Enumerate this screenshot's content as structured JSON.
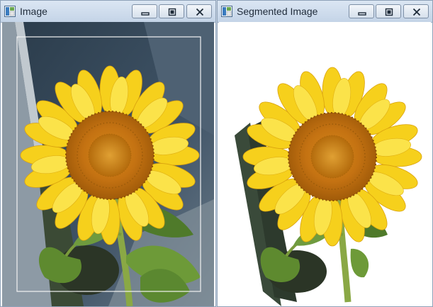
{
  "windows": [
    {
      "title": "Image",
      "icon": "image-window-icon",
      "buttons": [
        "minimize-icon",
        "maximize-icon",
        "close-icon"
      ]
    },
    {
      "title": "Segmented Image",
      "icon": "image-window-icon",
      "buttons": [
        "minimize-icon",
        "maximize-icon",
        "close-icon"
      ]
    }
  ],
  "colors": {
    "petal": "#f7d21a",
    "petal_dark": "#e4a90e",
    "disc_outer": "#c8780e",
    "disc_inner": "#a85c08",
    "leaf": "#5e8a2f",
    "stem": "#8aa845",
    "background_scene": "#2f4050",
    "segmented_background": "#ffffff",
    "selection_rectangle": "#f2f2f2"
  }
}
